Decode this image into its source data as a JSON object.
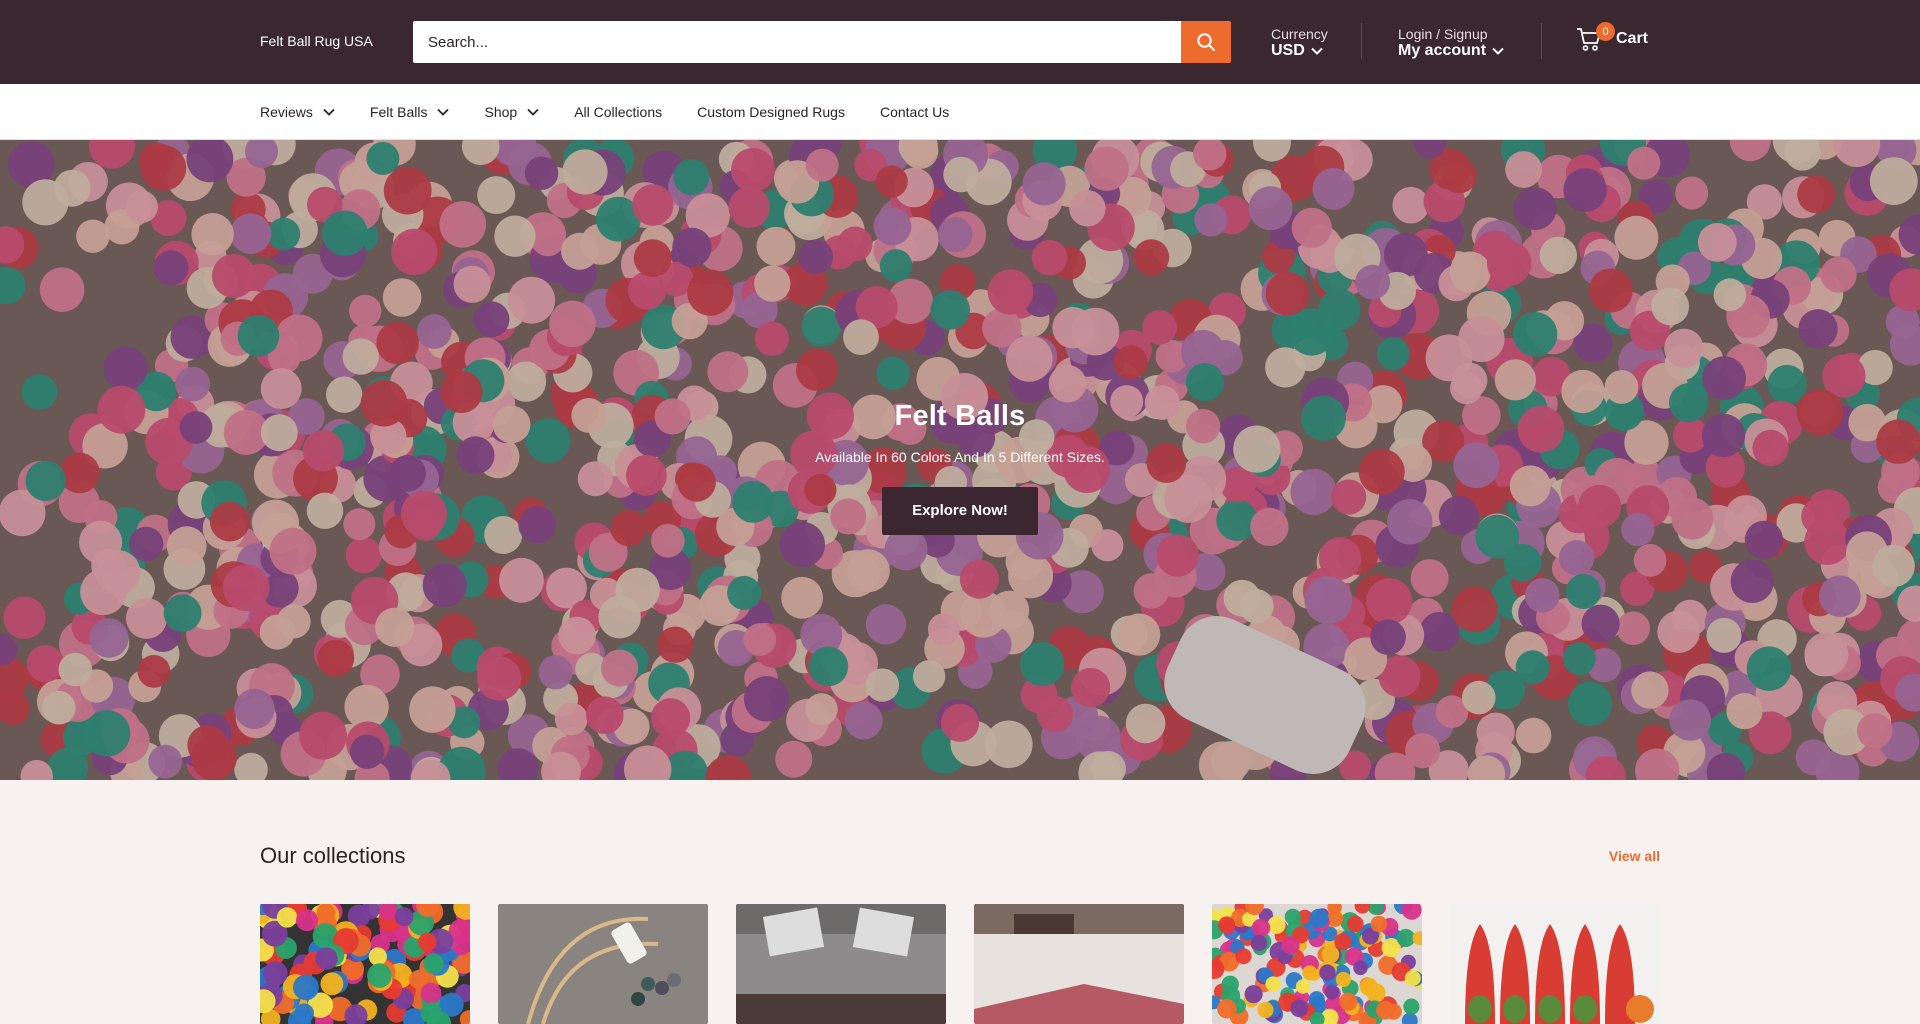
{
  "header": {
    "logo_text": "Felt Ball Rug USA",
    "search_placeholder": "Search...",
    "currency_label": "Currency",
    "currency_value": "USD",
    "login_label": "Login / Signup",
    "account_label": "My account",
    "cart_count": "0",
    "cart_label": "Cart"
  },
  "nav": {
    "items": [
      {
        "label": "Reviews",
        "dropdown": true
      },
      {
        "label": "Felt Balls",
        "dropdown": true
      },
      {
        "label": "Shop",
        "dropdown": true
      },
      {
        "label": "All Collections",
        "dropdown": false
      },
      {
        "label": "Custom Designed Rugs",
        "dropdown": false
      },
      {
        "label": "Contact Us",
        "dropdown": false
      }
    ]
  },
  "hero": {
    "title": "Felt Balls",
    "subtitle": "Available In 60 Colors And In 5 Different Sizes.",
    "button_label": "Explore Now!"
  },
  "collections": {
    "title": "Our collections",
    "view_all_label": "View all",
    "cards": [
      {
        "image": "colorful-felt-balls-image"
      },
      {
        "image": "rug-making-supplies-image"
      },
      {
        "image": "sofa-cushions-image"
      },
      {
        "image": "rug-on-floor-image"
      },
      {
        "image": "round-felt-ball-rug-image"
      },
      {
        "image": "felt-slippers-image"
      }
    ]
  },
  "colors": {
    "header_bg": "#3a2730",
    "accent": "#ee6b2e",
    "page_bg": "#f7f1ef"
  },
  "icons": {
    "search": "search-icon",
    "chevron": "chevron-down-icon",
    "cart": "cart-icon"
  }
}
